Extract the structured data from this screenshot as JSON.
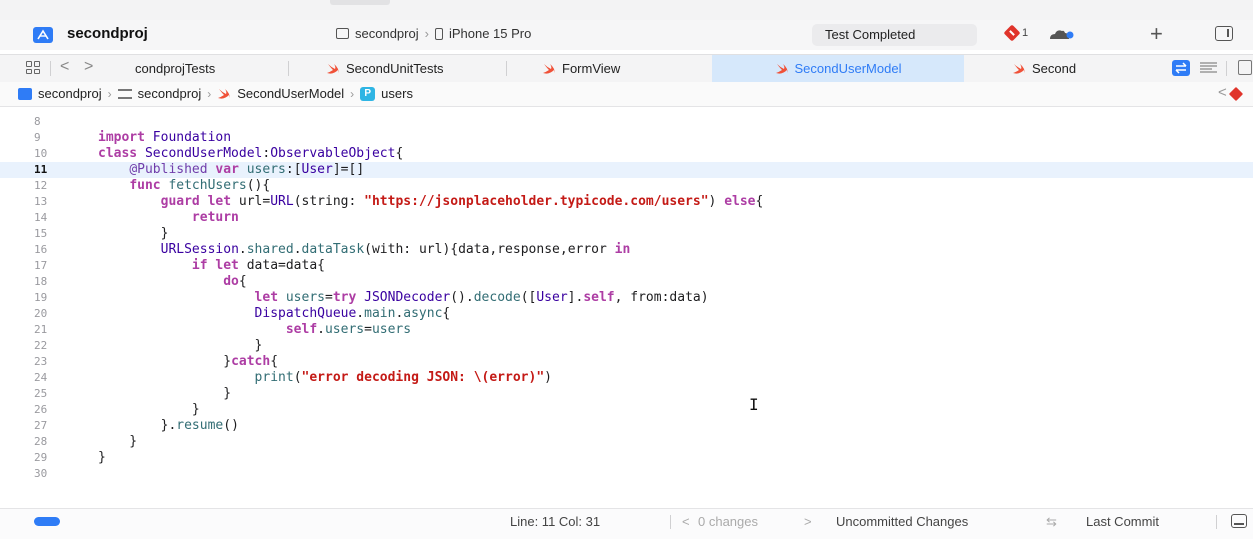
{
  "toolbar": {
    "project_title": "secondproj",
    "scheme_project": "secondproj",
    "scheme_separator": "›",
    "scheme_device": "iPhone 15 Pro",
    "status": "Test Completed",
    "issue_count": "1",
    "add_label": "+"
  },
  "tabs": [
    {
      "label": "condprojTests",
      "active": false
    },
    {
      "label": "SecondUnitTests",
      "active": false
    },
    {
      "label": "FormView",
      "active": false
    },
    {
      "label": "SecondUserModel",
      "active": true
    },
    {
      "label": "Second",
      "active": false
    }
  ],
  "breadcrumb": {
    "items": [
      "secondproj",
      "secondproj",
      "SecondUserModel",
      "users"
    ],
    "badge": "P",
    "separator": "›"
  },
  "editor": {
    "lines": [
      {
        "n": "8",
        "text": ""
      },
      {
        "n": "9",
        "text": "import Foundation"
      },
      {
        "n": "10",
        "text": "class SecondUserModel:ObservableObject{"
      },
      {
        "n": "11",
        "text": "    @Published var users:[User]=[]"
      },
      {
        "n": "12",
        "text": "    func fetchUsers(){"
      },
      {
        "n": "13",
        "text": "        guard let url=URL(string: \"https://jsonplaceholder.typicode.com/users\") else{"
      },
      {
        "n": "14",
        "text": "            return"
      },
      {
        "n": "15",
        "text": "        }"
      },
      {
        "n": "16",
        "text": "        URLSession.shared.dataTask(with: url){data,response,error in"
      },
      {
        "n": "17",
        "text": "            if let data=data{"
      },
      {
        "n": "18",
        "text": "                do{"
      },
      {
        "n": "19",
        "text": "                    let users=try JSONDecoder().decode([User].self, from:data)"
      },
      {
        "n": "20",
        "text": "                    DispatchQueue.main.async{"
      },
      {
        "n": "21",
        "text": "                        self.users=users"
      },
      {
        "n": "22",
        "text": "                    }"
      },
      {
        "n": "23",
        "text": "                }catch{"
      },
      {
        "n": "24",
        "text": "                    print(\"error decoding JSON: \\(error)\")"
      },
      {
        "n": "25",
        "text": "                }"
      },
      {
        "n": "26",
        "text": "            }"
      },
      {
        "n": "27",
        "text": "        }.resume()"
      },
      {
        "n": "28",
        "text": "    }"
      },
      {
        "n": "29",
        "text": "}"
      },
      {
        "n": "30",
        "text": ""
      }
    ],
    "current_line": "11",
    "cursor_glyph": "I"
  },
  "statusbar": {
    "position": "Line: 11  Col: 31",
    "changes": "0 changes",
    "uncommitted": "Uncommitted Changes",
    "last_commit": "Last Commit"
  },
  "colors": {
    "accent": "#2f7cf6",
    "keyword": "#ad3da4",
    "string": "#c41a16",
    "type": "#3900a0",
    "error": "#e0342b"
  },
  "icons": [
    "app-icon",
    "scheme-icon",
    "device-icon",
    "error-icon",
    "cloud-icon",
    "plus-icon",
    "sidebar-icon",
    "grid-icon",
    "swift-file-icon",
    "link-icon",
    "lines-icon",
    "property-badge-icon"
  ]
}
